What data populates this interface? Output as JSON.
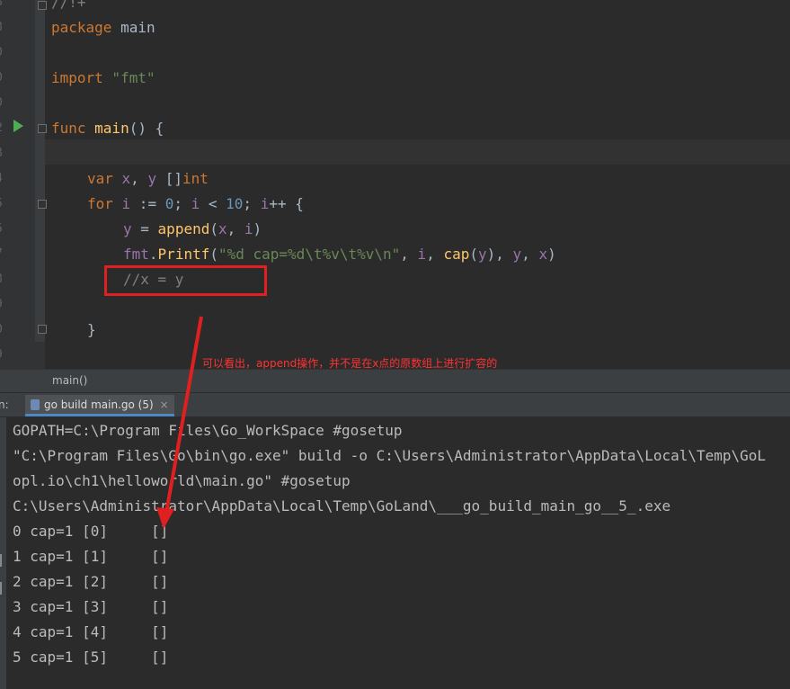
{
  "editor": {
    "gutter_numbers": [
      "8",
      "8",
      "0",
      "0",
      "0",
      "2",
      "8",
      "4",
      "5",
      "5",
      "7",
      "8",
      "9",
      "0",
      "9"
    ],
    "lines": {
      "l0": "//!+",
      "l1_kw": "package",
      "l1_name": " main",
      "l3_kw": "import",
      "l3_str": " \"fmt\"",
      "l5_kw": "func",
      "l5_fn": " main",
      "l5_rest": "() {",
      "l7_kw": "var",
      "l7_a": " x",
      "l7_b": ", ",
      "l7_c": "y",
      "l7_d": " []",
      "l7_e": "int",
      "l8_kw": "for",
      "l8_a": " i",
      "l8_b": " := ",
      "l8_c": "0",
      "l8_d": "; ",
      "l8_e": "i",
      "l8_f": " < ",
      "l8_g": "10",
      "l8_h": "; ",
      "l8_i": "i",
      "l8_j": "++ {",
      "l9_a": "y",
      "l9_b": " = ",
      "l9_c": "append",
      "l9_d": "(",
      "l9_e": "x",
      "l9_f": ", ",
      "l9_g": "i",
      "l9_h": ")",
      "l10_a": "fmt",
      "l10_b": ".",
      "l10_c": "Printf",
      "l10_d": "(",
      "l10_e": "\"%d cap=%d\\t%v\\t%v\\n\"",
      "l10_f": ", ",
      "l10_g": "i",
      "l10_h": ", ",
      "l10_i": "cap",
      "l10_j": "(",
      "l10_k": "y",
      "l10_l": "), ",
      "l10_m": "y",
      "l10_n": ", ",
      "l10_o": "x",
      "l10_p": ")",
      "l11": "//x = y",
      "l13": "}"
    },
    "annotation": "可以看出，append操作，并不是在x点的原数组上进行扩容的",
    "highlight_color": "#e02020"
  },
  "breadcrumb": {
    "label": "main()"
  },
  "run_panel": {
    "prefix": "n:",
    "tab_label": "go build main.go (5)",
    "tab_close": "×"
  },
  "console": {
    "lines": [
      "GOPATH=C:\\Program Files\\Go_WorkSpace #gosetup",
      "\"C:\\Program Files\\Go\\bin\\go.exe\" build -o C:\\Users\\Administrator\\AppData\\Local\\Temp\\GoL",
      "opl.io\\ch1\\helloworld\\main.go\" #gosetup",
      "C:\\Users\\Administrator\\AppData\\Local\\Temp\\GoLand\\___go_build_main_go__5_.exe",
      "0 cap=1 [0]     []",
      "1 cap=1 [1]     []",
      "2 cap=1 [2]     []",
      "3 cap=1 [3]     []",
      "4 cap=1 [4]     []",
      "5 cap=1 [5]     []"
    ]
  },
  "colors": {
    "background": "#2b2b2b",
    "keyword": "#cc7832",
    "function": "#ffc66d",
    "string": "#6a8759",
    "number": "#6897bb",
    "variable": "#9876aa",
    "comment": "#808080",
    "arrow": "#e02020"
  }
}
